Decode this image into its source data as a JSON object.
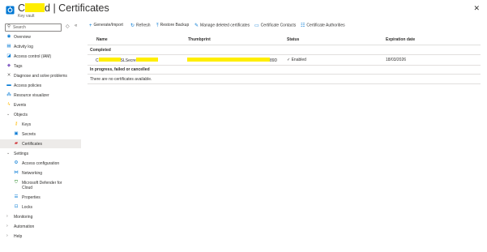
{
  "header": {
    "title_prefix": "C",
    "title_mid": "d | Certificates",
    "subtitle": "Key vault",
    "star_icon": "star-icon",
    "more_icon": "more-icon",
    "close_icon": "close-icon"
  },
  "sidebar": {
    "search_placeholder": "Search",
    "items": [
      {
        "label": "Overview",
        "icon": "overview-icon"
      },
      {
        "label": "Activity log",
        "icon": "activity-log-icon"
      },
      {
        "label": "Access control (IAM)",
        "icon": "iam-icon"
      },
      {
        "label": "Tags",
        "icon": "tag-icon"
      },
      {
        "label": "Diagnose and solve problems",
        "icon": "wrench-icon"
      },
      {
        "label": "Access policies",
        "icon": "access-policies-icon"
      },
      {
        "label": "Resource visualizer",
        "icon": "visualizer-icon"
      },
      {
        "label": "Events",
        "icon": "lightning-icon"
      },
      {
        "label": "Objects"
      },
      {
        "label": "Keys",
        "icon": "key-icon"
      },
      {
        "label": "Secrets",
        "icon": "secret-icon"
      },
      {
        "label": "Certificates",
        "icon": "certificate-icon"
      },
      {
        "label": "Settings"
      },
      {
        "label": "Access configuration",
        "icon": "config-icon"
      },
      {
        "label": "Networking",
        "icon": "network-icon"
      },
      {
        "label": "Microsoft Defender for",
        "label2": "Cloud",
        "icon": "defender-icon"
      },
      {
        "label": "Properties",
        "icon": "properties-icon"
      },
      {
        "label": "Locks",
        "icon": "lock-icon"
      },
      {
        "label": "Monitoring"
      },
      {
        "label": "Automation"
      },
      {
        "label": "Help"
      }
    ]
  },
  "toolbar": {
    "generate_import": "Generate/Import",
    "refresh": "Refresh",
    "restore_backup": "Restore Backup",
    "manage_deleted": "Manage deleted certificates",
    "contacts": "Certificate Contacts",
    "authorities": "Certificate Authorities"
  },
  "table": {
    "columns": [
      "Name",
      "Thumbprint",
      "Status",
      "Expiration date"
    ],
    "groups": {
      "completed": "Completed",
      "in_progress": "In progress, failed or cancelled"
    },
    "rows": [
      {
        "name_prefix": "C",
        "name_mid": "SLSecre",
        "thumb_suffix": "89D",
        "status": "Enabled",
        "expiration": "18/03/2026"
      }
    ],
    "empty_message": "There are no certificates available."
  },
  "colors": {
    "accent": "#0078d4",
    "redaction": "#ffee00",
    "selected_bg": "#edebe9"
  }
}
